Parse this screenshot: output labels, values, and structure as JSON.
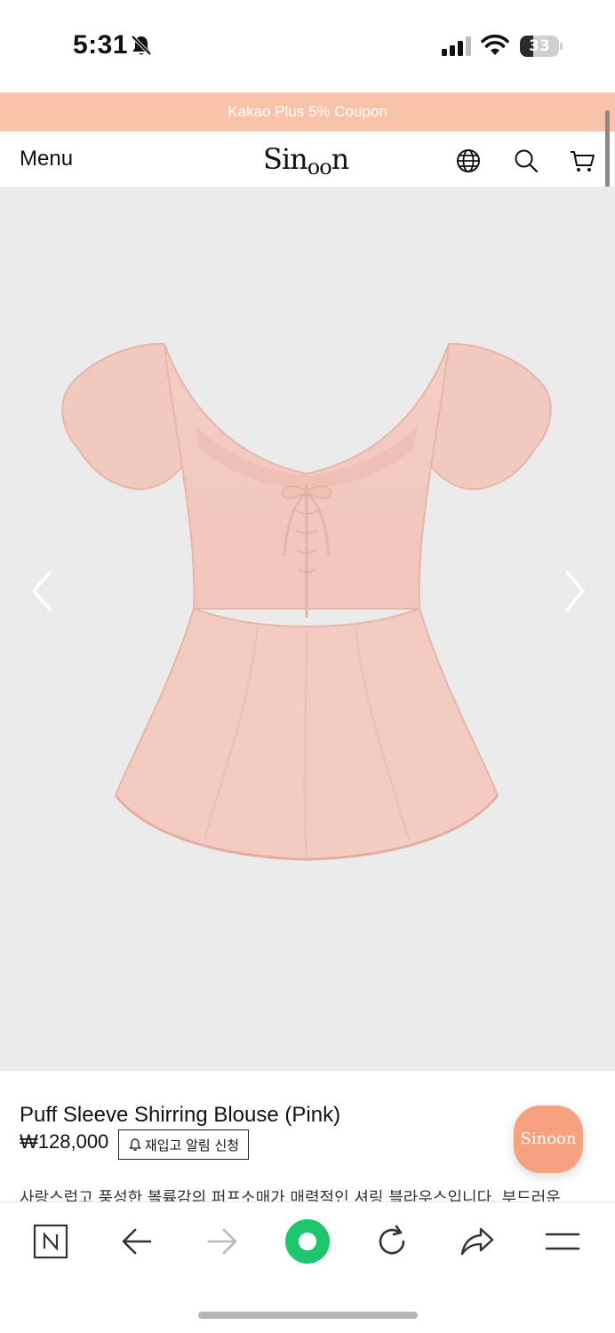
{
  "status_bar": {
    "time": "5:31",
    "battery_level": "33",
    "icons": [
      "bell-off-icon",
      "cellular-signal-icon",
      "wifi-icon",
      "battery-icon"
    ]
  },
  "promo_banner": {
    "text": "Kakao Plus 5% Coupon",
    "background_color": "#f9c3a8"
  },
  "header": {
    "menu_label": "Menu",
    "logo_text_main": "Sin",
    "logo_text_lo": "oo",
    "logo_text_end": "n",
    "icons": [
      "globe-icon",
      "search-icon",
      "cart-icon"
    ]
  },
  "gallery": {
    "image": "pink-puff-sleeve-blouse",
    "nav": [
      "chevron-left-icon",
      "chevron-right-icon"
    ]
  },
  "product": {
    "name": "Puff Sleeve Shirring Blouse (Pink)",
    "price": "₩128,000",
    "restock_button_label": "재입고 알림 신청",
    "description": "사랑스럽고 풍성한 볼륨감의 퍼프소매가 매력적인 셔링 블라우스입니다. 부드러운"
  },
  "floating_badge": {
    "text": "Sinoon",
    "color": "#f6a27f"
  },
  "browser_bar": {
    "icons": [
      "naver-n-icon",
      "back-arrow-icon",
      "forward-arrow-icon",
      "green-home-icon",
      "reload-icon",
      "share-icon",
      "menu-hamburger-icon"
    ],
    "accent_color": "#1ec66e"
  }
}
